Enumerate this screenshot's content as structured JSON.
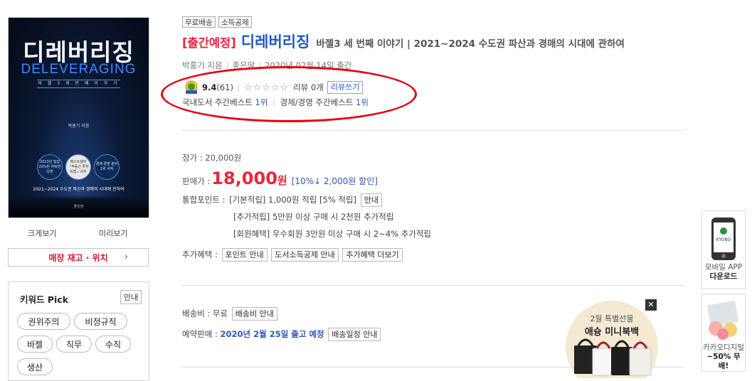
{
  "cover": {
    "title_ko": "디레버리징",
    "title_en": "DELEVERAGING",
    "subtitle": "바 젤 3 세 번 째 이 야 기",
    "author": "박홍기 지음",
    "badges": [
      "2022년 집값 20%만 하락한다면",
      "베스트셀러 『부동산 투자 비법』저자",
      "경제·경영 분야 1위 서적"
    ],
    "bottom": "2021~2024 수도권 파산과 경매의 시대에 관하여",
    "publisher": "좋은땅"
  },
  "left": {
    "zoom_label": "크게보기",
    "preview_label": "미리보기",
    "store_button": "매장 재고 · 위치",
    "store_chevron": "›",
    "keyword_title": "키워드 Pick",
    "keyword_info": "안내",
    "keywords": [
      "권위주의",
      "비정규직",
      "바젤",
      "직무",
      "수직",
      "생산"
    ]
  },
  "tags": [
    "무료배송",
    "소득공제"
  ],
  "product": {
    "pre_tag": "[출간예정]",
    "title": "디레버리징",
    "subtitle": "바젤3 세 번째 이야기 | 2021~2024 수도권 파산과 경매의 시대에 관하여",
    "author": "박홍기 지음",
    "publisher": "좋은땅",
    "pub_date": "2020년 02월 14일 출간",
    "rating_score": "9.4",
    "rating_count": "(61)",
    "stars": "☆☆☆☆☆",
    "review_label": "리뷰 0개",
    "review_write": "리뷰쓰기",
    "best_domestic_label": "국내도서 주간베스트",
    "best_domestic_rank": "1위",
    "best_category_label": "경제/경영 주간베스트",
    "best_category_rank": "1위"
  },
  "price": {
    "list_price": "정가 : 20,000원",
    "sale_label": "판매가 :",
    "sale_price": "18,000",
    "sale_unit": "원",
    "discount": "[10%↓ 2,000원 할인]",
    "points_label": "통합포인트 :",
    "points_basic": "[기본적립] 1,000원 적립 [5% 적립]",
    "points_info": "안내",
    "points_extra": "[추가적립] 5만원 이상 구매 시 2천원 추가적립",
    "points_member": "[회원혜택] 우수회원 3만원 이상 구매 시 2~4% 추가적립",
    "benefit_label": "추가혜택 :",
    "benefit_buttons": [
      "포인트 안내",
      "도서소득공제 안내",
      "추가혜택 더보기"
    ]
  },
  "shipping": {
    "fee_label": "배송비 : 무료",
    "fee_info": "배송비 안내",
    "reserve_label": "예약판매 :",
    "reserve_date": "2020년 2월 25일 출고 예정",
    "reserve_info": "배송일정 안내"
  },
  "ad": {
    "line1": "2월 특별선물",
    "line2": "애슝 미니북백",
    "close": "✕"
  },
  "sidebar": {
    "app_brand": "KYOBO",
    "app_label1": "모바일 APP",
    "app_label2": "다운로드",
    "kakao_label1": "카카오디지털",
    "kakao_label2": "~50% 무배!"
  }
}
